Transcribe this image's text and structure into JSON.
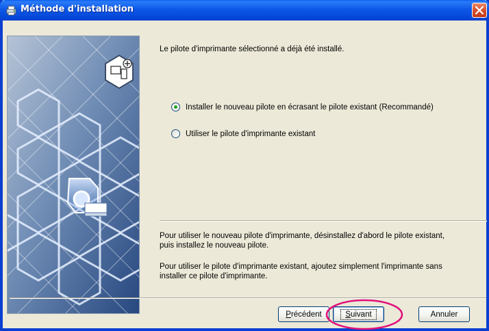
{
  "window": {
    "title": "Méthode d'installation"
  },
  "message": {
    "header": "Le pilote d'imprimante sélectionné a déjà été installé.",
    "note1_line1": "Pour utiliser le nouveau pilote d'imprimante, désinstallez d'abord le pilote existant,",
    "note1_line2": "puis installez le nouveau pilote.",
    "note2_line1": "Pour utiliser le pilote d'imprimante existant, ajoutez simplement l'imprimante sans",
    "note2_line2": "installer ce pilote d'imprimante."
  },
  "options": [
    {
      "label": "Installer le nouveau pilote en écrasant le pilote existant (Recommandé)",
      "selected": true
    },
    {
      "label": "Utiliser le pilote d'imprimante existant",
      "selected": false
    }
  ],
  "buttons": {
    "back_accel": "P",
    "back_rest": "récédent",
    "next_accel": "S",
    "next_rest": "uivant",
    "cancel": "Annuler"
  },
  "colors": {
    "titlebar": "#0a5ff2",
    "dialog_bg": "#ece9d8",
    "highlight": "#e0107a",
    "radio_checked": "#21a121"
  },
  "icons": {
    "title": "printer-window-icon",
    "close": "close-icon",
    "panel_top": "computer-add-icon",
    "panel_center": "printer-cube-icon"
  }
}
